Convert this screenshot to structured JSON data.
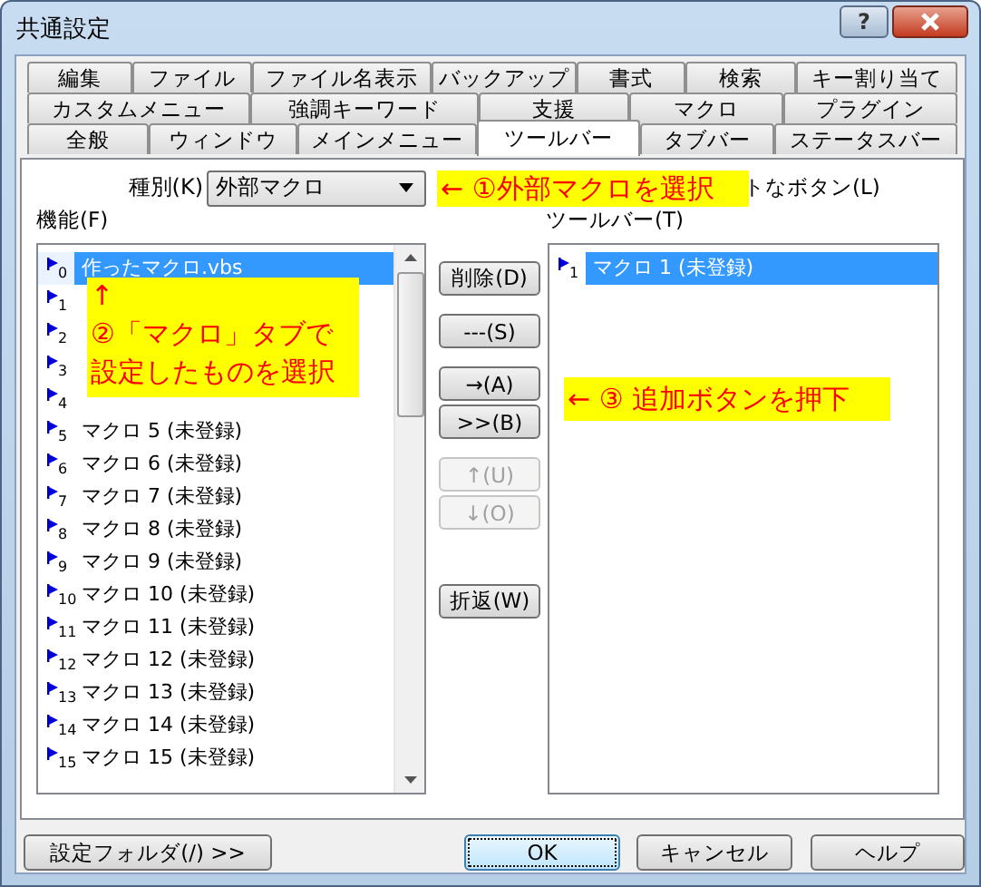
{
  "window": {
    "title": "共通設定",
    "help_button": "?"
  },
  "tab_rows": [
    [
      {
        "label": "編集",
        "selected": false
      },
      {
        "label": "ファイル",
        "selected": false
      },
      {
        "label": "ファイル名表示",
        "selected": false
      },
      {
        "label": "バックアップ",
        "selected": false
      },
      {
        "label": "書式",
        "selected": false
      },
      {
        "label": "検索",
        "selected": false
      },
      {
        "label": "キー割り当て",
        "selected": false
      }
    ],
    [
      {
        "label": "カスタムメニュー",
        "selected": false
      },
      {
        "label": "強調キーワード",
        "selected": false
      },
      {
        "label": "支援",
        "selected": false
      },
      {
        "label": "マクロ",
        "selected": false
      },
      {
        "label": "プラグイン",
        "selected": false
      }
    ],
    [
      {
        "label": "全般",
        "selected": false
      },
      {
        "label": "ウィンドウ",
        "selected": false
      },
      {
        "label": "メインメニュー",
        "selected": false
      },
      {
        "label": "ツールバー",
        "selected": true
      },
      {
        "label": "タブバー",
        "selected": false
      },
      {
        "label": "ステータスバー",
        "selected": false
      }
    ]
  ],
  "type_selector": {
    "label": "種別(K)",
    "value": "外部マクロ"
  },
  "partial_label": "トなボタン(L)",
  "functions": {
    "label": "機能(F)",
    "items": [
      {
        "index": "0",
        "text": "作ったマクロ.vbs",
        "selected": true
      },
      {
        "index": "1",
        "selected": false
      },
      {
        "index": "2",
        "selected": false
      },
      {
        "index": "3",
        "selected": false
      },
      {
        "index": "4",
        "selected": false
      },
      {
        "index": "5",
        "text": "マクロ 5 (未登録)",
        "selected": false
      },
      {
        "index": "6",
        "text": "マクロ 6 (未登録)",
        "selected": false
      },
      {
        "index": "7",
        "text": "マクロ 7 (未登録)",
        "selected": false
      },
      {
        "index": "8",
        "text": "マクロ 8 (未登録)",
        "selected": false
      },
      {
        "index": "9",
        "text": "マクロ 9 (未登録)",
        "selected": false
      },
      {
        "index": "10",
        "text": "マクロ 10 (未登録)",
        "selected": false
      },
      {
        "index": "11",
        "text": "マクロ 11 (未登録)",
        "selected": false
      },
      {
        "index": "12",
        "text": "マクロ 12 (未登録)",
        "selected": false
      },
      {
        "index": "13",
        "text": "マクロ 13 (未登録)",
        "selected": false
      },
      {
        "index": "14",
        "text": "マクロ 14 (未登録)",
        "selected": false
      },
      {
        "index": "15",
        "text": "マクロ 15 (未登録)",
        "selected": false
      }
    ]
  },
  "toolbar": {
    "label": "ツールバー(T)",
    "items": [
      {
        "index": "1",
        "text": "マクロ 1 (未登録)",
        "selected": true
      }
    ]
  },
  "button_groups": [
    [
      {
        "label": "削除(D)",
        "disabled": false
      }
    ],
    [
      {
        "label": "---(S)",
        "disabled": false
      }
    ],
    [
      {
        "label": "→(A)",
        "disabled": false
      },
      {
        "label": ">>(B)",
        "disabled": false
      }
    ],
    [
      {
        "label": "↑(U)",
        "disabled": true
      },
      {
        "label": "↓(O)",
        "disabled": true
      }
    ],
    [
      {
        "label": "折返(W)",
        "disabled": false
      }
    ]
  ],
  "footer_buttons": [
    {
      "label": "設定フォルダ(/) >>",
      "focused": false
    },
    {
      "label": "OK",
      "focused": true
    },
    {
      "label": "キャンセル",
      "focused": false
    },
    {
      "label": "ヘルプ",
      "focused": false
    }
  ],
  "annotations": [
    {
      "lines": [
        "← ①外部マクロを選択"
      ]
    },
    {
      "lines": [
        "↑",
        "②「マクロ」タブで",
        "設定したものを選択"
      ]
    },
    {
      "lines": [
        "← ③ 追加ボタンを押下"
      ]
    }
  ]
}
